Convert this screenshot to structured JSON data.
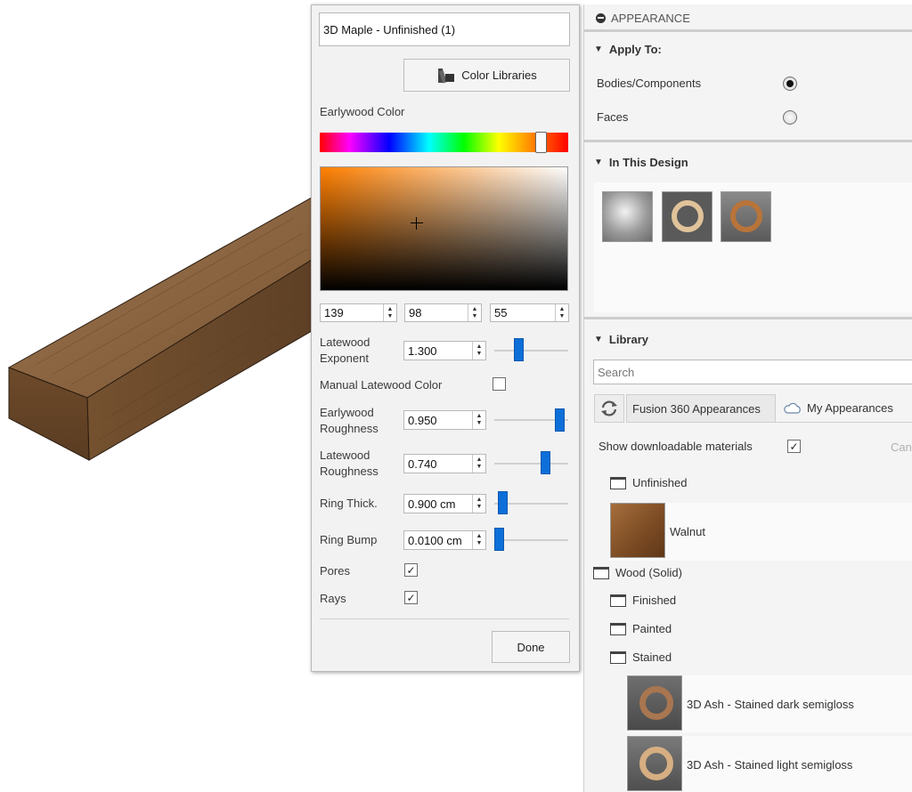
{
  "editor": {
    "material_name": "3D Maple - Unfinished (1)",
    "color_libraries_label": "Color Libraries",
    "earlywood_color_label": "Earlywood Color",
    "rgb": {
      "r": "139",
      "g": "98",
      "b": "55"
    },
    "latewood_exponent_label": "Latewood Exponent",
    "latewood_exponent_value": "1.300",
    "latewood_exponent_level": 0.35,
    "manual_latewood_color_label": "Manual Latewood Color",
    "manual_latewood_color_checked": false,
    "earlywood_roughness_label": "Earlywood Roughness",
    "earlywood_roughness_value": "0.950",
    "earlywood_roughness_level": 0.95,
    "latewood_roughness_label": "Latewood Roughness",
    "latewood_roughness_value": "0.740",
    "latewood_roughness_level": 0.74,
    "ring_thick_label": "Ring Thick.",
    "ring_thick_value": "0.900 cm",
    "ring_thick_level": 0.05,
    "ring_bump_label": "Ring Bump",
    "ring_bump_value": "0.0100 cm",
    "ring_bump_level": 0.02,
    "pores_label": "Pores",
    "pores_checked": true,
    "rays_label": "Rays",
    "rays_checked": true,
    "done_label": "Done"
  },
  "panel": {
    "title": "APPEARANCE",
    "apply_to_header": "Apply To:",
    "apply_to_options": [
      {
        "label": "Bodies/Components",
        "selected": true
      },
      {
        "label": "Faces",
        "selected": false
      }
    ],
    "in_this_design_header": "In This Design",
    "library_header": "Library",
    "search_placeholder": "Search",
    "tab_fusion": "Fusion 360 Appearances",
    "tab_my": "My Appearances",
    "show_downloadable_label": "Show downloadable materials",
    "show_downloadable_checked": true,
    "cancel_partial": "Can",
    "tree": {
      "unfinished_folder": "Unfinished",
      "walnut_label": "Walnut",
      "wood_solid_folder": "Wood (Solid)",
      "finished_folder": "Finished",
      "painted_folder": "Painted",
      "stained_folder": "Stained",
      "ash_dark_label": "3D Ash - Stained dark semigloss",
      "ash_light_label": "3D Ash - Stained light semigloss"
    }
  },
  "colors": {
    "accent": "#0d6fd8",
    "wood_early": "#8b6237"
  },
  "icons": {
    "color_libraries": "color-swatch-icon",
    "refresh": "refresh-icon",
    "cloud": "cloud-icon",
    "collapse": "minus-circle-icon"
  }
}
